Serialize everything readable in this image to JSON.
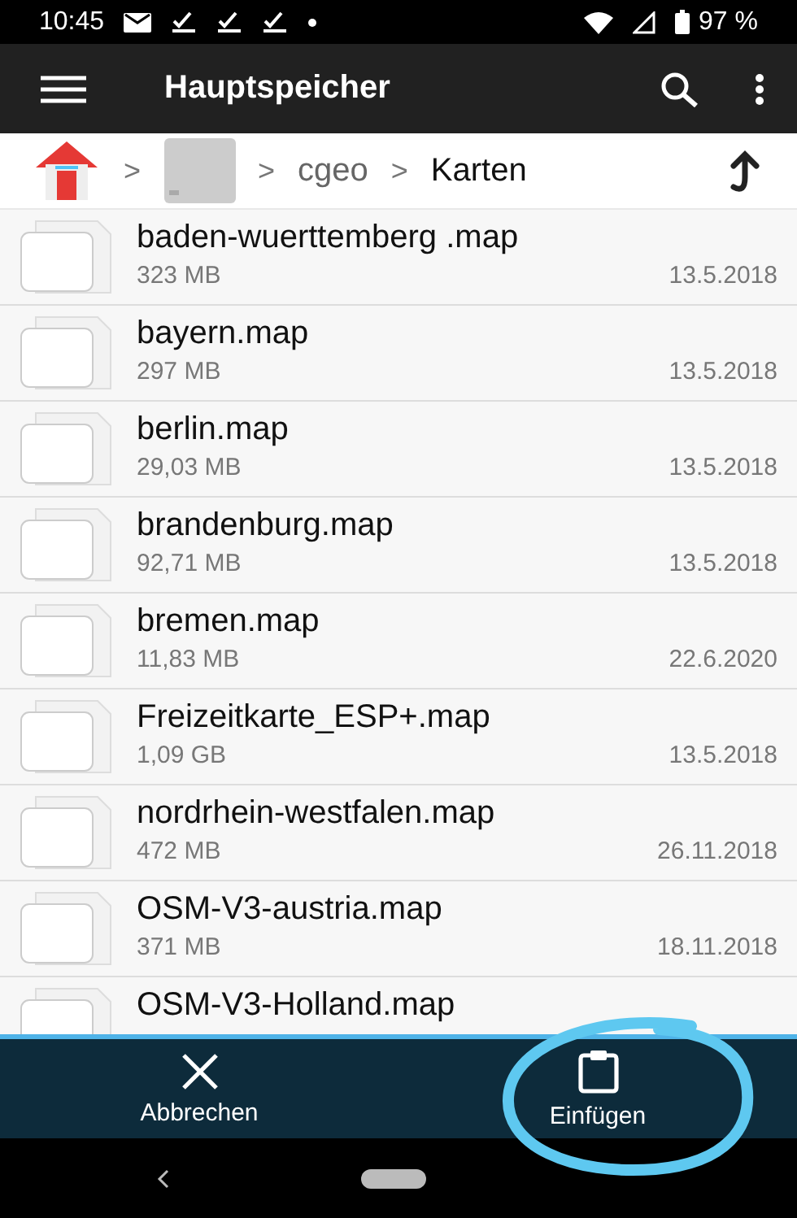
{
  "status_bar": {
    "time": "10:45",
    "battery": "97 %"
  },
  "toolbar": {
    "title": "Hauptspeicher"
  },
  "breadcrumb": [
    {
      "kind": "home",
      "separator": ">"
    },
    {
      "kind": "drive",
      "separator": ">"
    },
    {
      "kind": "text",
      "label": "cgeo",
      "separator": ">",
      "current": false
    },
    {
      "kind": "text",
      "label": "Karten",
      "current": true
    }
  ],
  "files": [
    {
      "name": "baden-wuerttemberg .map",
      "size": "323 MB",
      "date": "13.5.2018"
    },
    {
      "name": "bayern.map",
      "size": "297 MB",
      "date": "13.5.2018"
    },
    {
      "name": "berlin.map",
      "size": "29,03 MB",
      "date": "13.5.2018"
    },
    {
      "name": "brandenburg.map",
      "size": "92,71 MB",
      "date": "13.5.2018"
    },
    {
      "name": "bremen.map",
      "size": "11,83 MB",
      "date": "22.6.2020"
    },
    {
      "name": "Freizeitkarte_ESP+.map",
      "size": "1,09 GB",
      "date": "13.5.2018"
    },
    {
      "name": "nordrhein-westfalen.map",
      "size": "472 MB",
      "date": "26.11.2018"
    },
    {
      "name": "OSM-V3-austria.map",
      "size": "371 MB",
      "date": "18.11.2018"
    },
    {
      "name": "OSM-V3-Holland.map"
    }
  ],
  "action_bar": [
    {
      "kind": "cancel",
      "label": "Abbrechen",
      "circled": false
    },
    {
      "kind": "paste",
      "label": "Einfügen",
      "circled": true
    }
  ]
}
